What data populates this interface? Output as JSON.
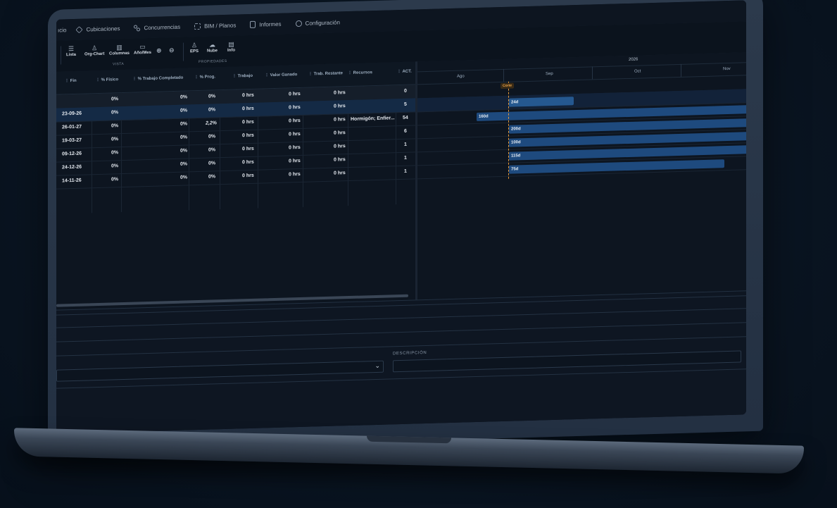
{
  "nav": {
    "items": [
      {
        "label": "ıcio",
        "icon": "home-icon"
      },
      {
        "label": "Cubicaciones",
        "icon": "cube-icon"
      },
      {
        "label": "Concurrencias",
        "icon": "flow-icon"
      },
      {
        "label": "BIM / Planos",
        "icon": "scan-icon"
      },
      {
        "label": "Informes",
        "icon": "document-icon"
      },
      {
        "label": "Configuración",
        "icon": "gear-icon"
      }
    ]
  },
  "toolbar": {
    "buttons": [
      {
        "label": "Lista",
        "glyph": "☰",
        "icon": "list-icon"
      },
      {
        "label": "Org-Chart",
        "glyph": "♙",
        "icon": "org-chart-icon"
      },
      {
        "label": "Columnas",
        "glyph": "▥",
        "icon": "columns-icon"
      },
      {
        "label": "Año/Mes",
        "glyph": "▭",
        "icon": "calendar-icon"
      },
      {
        "label": "",
        "glyph": "⊕",
        "icon": "zoom-in-icon"
      },
      {
        "label": "",
        "glyph": "⊖",
        "icon": "zoom-out-icon"
      },
      {
        "label": "EPS",
        "glyph": "♙",
        "icon": "eps-icon"
      },
      {
        "label": "Nube",
        "glyph": "☁",
        "icon": "cloud-icon"
      },
      {
        "label": "Info",
        "glyph": "▤",
        "icon": "info-icon"
      }
    ],
    "groups": {
      "vista": "VISTA",
      "propiedades": "PROPIEDADES"
    }
  },
  "grid": {
    "headers": [
      "Fin",
      "% Físico",
      "% Trabajo Completado",
      "% Prog.",
      "Trabajo",
      "Valor Ganado",
      "Trab. Restante",
      "Recursos",
      "ACT."
    ],
    "rows": [
      {
        "fin": "",
        "fisico": "0%",
        "completado": "0%",
        "prog": "0%",
        "trabajo": "0 hrs",
        "valor": "0 hrs",
        "restante": "0 hrs",
        "recursos": "",
        "act": "0"
      },
      {
        "fin": "23-09-26",
        "fisico": "0%",
        "completado": "0%",
        "prog": "0%",
        "trabajo": "0 hrs",
        "valor": "0 hrs",
        "restante": "0 hrs",
        "recursos": "",
        "act": "5"
      },
      {
        "fin": "26-01-27",
        "fisico": "0%",
        "completado": "0%",
        "prog": "2,2%",
        "trabajo": "0 hrs",
        "valor": "0 hrs",
        "restante": "0 hrs",
        "recursos": "Hormigón; Enfier...",
        "act": "54"
      },
      {
        "fin": "19-03-27",
        "fisico": "0%",
        "completado": "0%",
        "prog": "0%",
        "trabajo": "0 hrs",
        "valor": "0 hrs",
        "restante": "0 hrs",
        "recursos": "",
        "act": "6"
      },
      {
        "fin": "09-12-26",
        "fisico": "0%",
        "completado": "0%",
        "prog": "0%",
        "trabajo": "0 hrs",
        "valor": "0 hrs",
        "restante": "0 hrs",
        "recursos": "",
        "act": "1"
      },
      {
        "fin": "24-12-26",
        "fisico": "0%",
        "completado": "0%",
        "prog": "0%",
        "trabajo": "0 hrs",
        "valor": "0 hrs",
        "restante": "0 hrs",
        "recursos": "",
        "act": "1"
      },
      {
        "fin": "14-11-26",
        "fisico": "0%",
        "completado": "0%",
        "prog": "0%",
        "trabajo": "0 hrs",
        "valor": "0 hrs",
        "restante": "0 hrs",
        "recursos": "",
        "act": "1"
      }
    ]
  },
  "gantt": {
    "year": "2026",
    "months": [
      "Ago",
      "Sep",
      "Oct",
      "Nov"
    ],
    "today_label": "Corte",
    "bars": [
      "",
      "24d",
      "160d",
      "200d",
      "100d",
      "115d",
      "75d"
    ]
  },
  "form": {
    "descripcion_label": "DESCRIPCIÓN"
  },
  "colors": {
    "background": "#0a1522",
    "bar": "#1e4a7e",
    "today_marker": "#e99b3a",
    "selected_row": "#142a45"
  }
}
